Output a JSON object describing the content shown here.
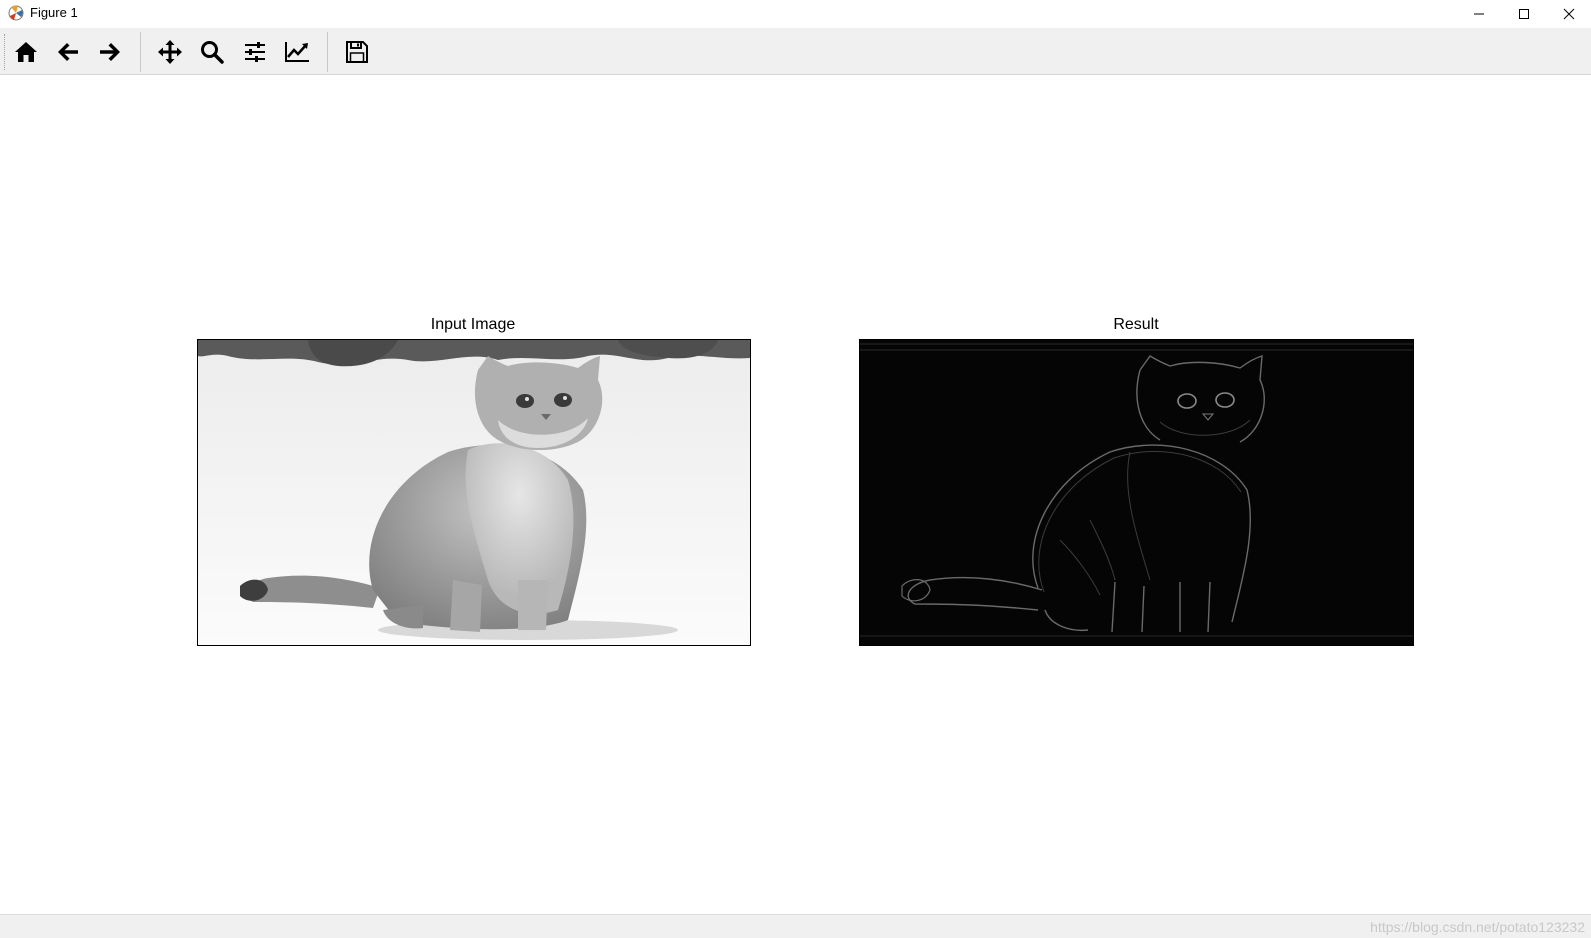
{
  "window": {
    "title": "Figure 1",
    "icons": {
      "app": "matplotlib-icon",
      "minimize": "minimize-icon",
      "maximize": "maximize-icon",
      "close": "close-icon"
    }
  },
  "toolbar": {
    "buttons": [
      {
        "name": "home",
        "icon": "home-icon"
      },
      {
        "name": "back",
        "icon": "arrow-left-icon"
      },
      {
        "name": "forward",
        "icon": "arrow-right-icon"
      },
      {
        "name": "pan",
        "icon": "move-icon"
      },
      {
        "name": "zoom",
        "icon": "magnifier-icon"
      },
      {
        "name": "configure-subplots",
        "icon": "sliders-icon"
      },
      {
        "name": "edit-axis",
        "icon": "line-chart-icon"
      },
      {
        "name": "save",
        "icon": "floppy-disk-icon"
      }
    ]
  },
  "figure": {
    "subplots": [
      {
        "title": "Input Image",
        "kind": "grayscale photo of a cat sitting in snow"
      },
      {
        "title": "Result",
        "kind": "edge-filtered grayscale image of the cat on black"
      }
    ]
  },
  "statusbar": {
    "watermark": "https://blog.csdn.net/potato123232"
  },
  "colors": {
    "toolbar_bg": "#f0f0f0",
    "canvas_bg": "#ffffff",
    "axes_border": "#000000",
    "result_bg": "#050505"
  }
}
